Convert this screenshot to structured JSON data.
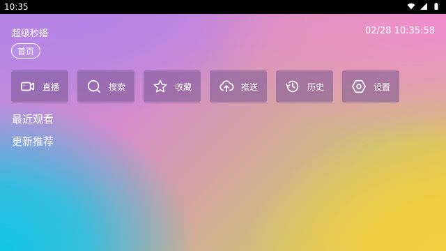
{
  "status_bar": {
    "time": "10:35"
  },
  "header": {
    "app_title": "超级秒播",
    "clock": "02/28 10:35:58"
  },
  "tabs": {
    "home": "首页"
  },
  "menu": [
    {
      "label": "直播",
      "icon": "video-camera-icon"
    },
    {
      "label": "搜索",
      "icon": "search-icon"
    },
    {
      "label": "收藏",
      "icon": "star-icon"
    },
    {
      "label": "推送",
      "icon": "cloud-upload-icon"
    },
    {
      "label": "历史",
      "icon": "history-icon"
    },
    {
      "label": "设置",
      "icon": "settings-hexagon-icon"
    }
  ],
  "sections": {
    "recent": "最近观看",
    "updates": "更新推荐"
  }
}
